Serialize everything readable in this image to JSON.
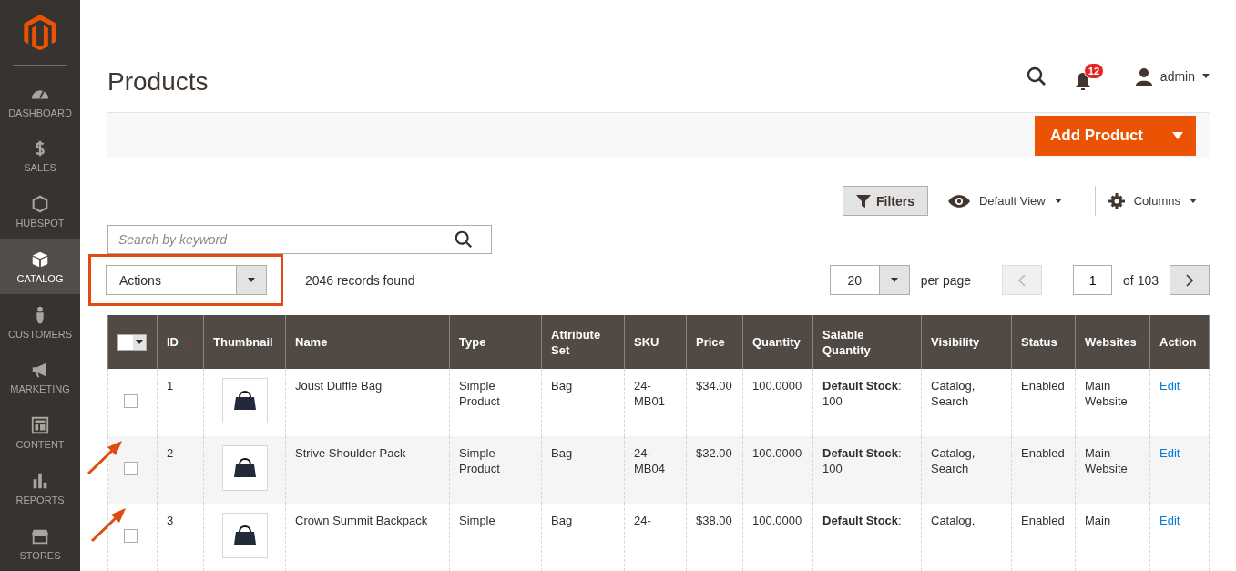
{
  "sidebar": {
    "items": [
      {
        "label": "DASHBOARD",
        "selected": false
      },
      {
        "label": "SALES",
        "selected": false
      },
      {
        "label": "HUBSPOT",
        "selected": false
      },
      {
        "label": "CATALOG",
        "selected": true
      },
      {
        "label": "CUSTOMERS",
        "selected": false
      },
      {
        "label": "MARKETING",
        "selected": false
      },
      {
        "label": "CONTENT",
        "selected": false
      },
      {
        "label": "REPORTS",
        "selected": false
      },
      {
        "label": "STORES",
        "selected": false
      }
    ]
  },
  "header": {
    "title": "Products",
    "notifications": "12",
    "user": "admin"
  },
  "page_actions": {
    "primary": "Add Product"
  },
  "toolbar": {
    "filters": "Filters",
    "view": "Default View",
    "columns": "Columns"
  },
  "search": {
    "placeholder": "Search by keyword"
  },
  "mass_actions": {
    "label": "Actions",
    "records": "2046 records found"
  },
  "pager": {
    "page_size": "20",
    "per_page": "per page",
    "page": "1",
    "of": "of 103"
  },
  "table": {
    "select_all": {
      "checked": false
    },
    "sort_indicator": "↓",
    "columns": [
      "ID",
      "Thumbnail",
      "Name",
      "Type",
      "Attribute Set",
      "SKU",
      "Price",
      "Quantity",
      "Salable Quantity",
      "Visibility",
      "Status",
      "Websites",
      "Action"
    ],
    "rows": [
      {
        "checked": false,
        "id": "1",
        "name": "Joust Duffle Bag",
        "type": "Simple Product",
        "attribute_set": "Bag",
        "sku": "24-MB01",
        "price": "$34.00",
        "quantity": "100.0000",
        "salable_label": "Default Stock",
        "salable_value": ": 100",
        "visibility": "Catalog, Search",
        "status": "Enabled",
        "websites": "Main Website",
        "action": "Edit"
      },
      {
        "checked": false,
        "id": "2",
        "name": "Strive Shoulder Pack",
        "type": "Simple Product",
        "attribute_set": "Bag",
        "sku": "24-MB04",
        "price": "$32.00",
        "quantity": "100.0000",
        "salable_label": "Default Stock",
        "salable_value": ": 100",
        "visibility": "Catalog, Search",
        "status": "Enabled",
        "websites": "Main Website",
        "action": "Edit"
      },
      {
        "checked": false,
        "id": "3",
        "name": "Crown Summit Backpack",
        "type": "Simple",
        "attribute_set": "Bag",
        "sku": "24-",
        "price": "$38.00",
        "quantity": "100.0000",
        "salable_label": "Default Stock",
        "salable_value": ":",
        "visibility": "Catalog,",
        "status": "Enabled",
        "websites": "Main",
        "action": "Edit"
      }
    ]
  }
}
